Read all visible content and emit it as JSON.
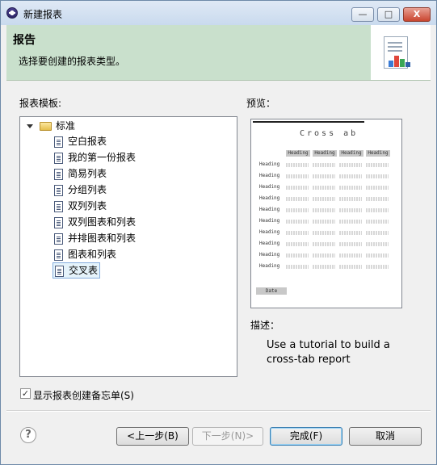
{
  "window": {
    "title": "新建报表",
    "controls": {
      "minimize": "—",
      "maximize": "□",
      "close": "X"
    }
  },
  "banner": {
    "title": "报告",
    "description": "选择要创建的报表类型。"
  },
  "templates": {
    "label": "报表模板:",
    "category": "标准",
    "items": [
      "空白报表",
      "我的第一份报表",
      "简易列表",
      "分组列表",
      "双列列表",
      "双列图表和列表",
      "并排图表和列表",
      "图表和列表",
      "交叉表"
    ],
    "selected_index": 8
  },
  "preview": {
    "label": "预览：",
    "title_text": "Cross  ab",
    "heading_text": "Heading",
    "date_text": "Date"
  },
  "description": {
    "label": "描述：",
    "text": "Use a tutorial to build a cross-tab report"
  },
  "memo_checkbox": {
    "label": "显示报表创建备忘单(S)",
    "checked": true
  },
  "buttons": {
    "help": "?",
    "back": "<上一步(B)",
    "next": "下一步(N)>",
    "finish": "完成(F)",
    "cancel": "取消"
  },
  "colors": {
    "banner_bg": "#c9e0cc",
    "selection": "#e5f3fb"
  }
}
